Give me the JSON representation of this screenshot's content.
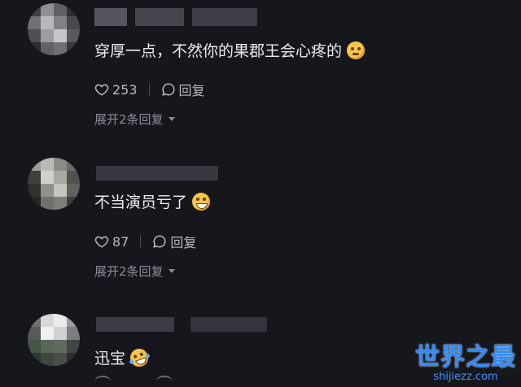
{
  "comments": [
    {
      "text": "穿厚一点，不然你的果郡王会心疼的",
      "emoji": "pleading-face",
      "likes": "253",
      "reply_label": "回复",
      "expand_label": "展开2条回复"
    },
    {
      "text": "不当演员亏了",
      "emoji": "grinning-face",
      "likes": "87",
      "reply_label": "回复",
      "expand_label": "展开2条回复"
    },
    {
      "text": "迅宝",
      "emoji": "rolling-laughing-face"
    }
  ],
  "watermark": {
    "title": "世界之最",
    "url": "shijiezz.com"
  },
  "colors": {
    "background": "#16161d",
    "text": "#ececef",
    "muted": "#8d8d96",
    "watermark": "#2f8bff"
  }
}
